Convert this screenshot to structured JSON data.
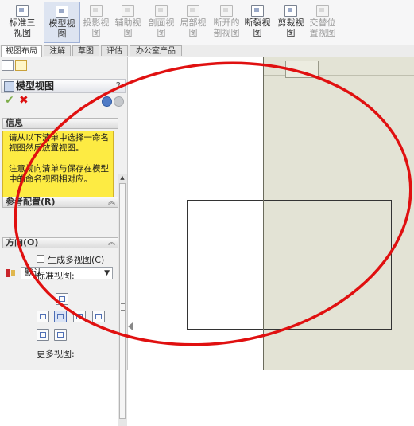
{
  "toolbar": {
    "buttons": [
      {
        "label_line1": "标准三",
        "label_line2": "视图",
        "icon": "standard-3-view-icon",
        "state": "normal"
      },
      {
        "label_line1": "模型视",
        "label_line2": "图",
        "icon": "model-view-icon",
        "state": "active"
      },
      {
        "label_line1": "投影视",
        "label_line2": "图",
        "icon": "projected-view-icon",
        "state": "disabled"
      },
      {
        "label_line1": "辅助视",
        "label_line2": "图",
        "icon": "auxiliary-view-icon",
        "state": "disabled"
      },
      {
        "label_line1": "剖面视",
        "label_line2": "图",
        "icon": "section-view-icon",
        "state": "disabled"
      },
      {
        "label_line1": "局部视",
        "label_line2": "图",
        "icon": "detail-view-icon",
        "state": "disabled"
      },
      {
        "label_line1": "断开的",
        "label_line2": "剖视图",
        "icon": "broken-out-section-icon",
        "state": "disabled"
      },
      {
        "label_line1": "断裂视",
        "label_line2": "图",
        "icon": "break-view-icon",
        "state": "normal"
      },
      {
        "label_line1": "剪裁视",
        "label_line2": "图",
        "icon": "crop-view-icon",
        "state": "normal"
      },
      {
        "label_line1": "交替位",
        "label_line2": "置视图",
        "icon": "alternate-position-view-icon",
        "state": "disabled"
      }
    ]
  },
  "tabs": [
    "视图布局",
    "注解",
    "草图",
    "评估",
    "办公室产品"
  ],
  "panel": {
    "title": "模型视图",
    "help": "?",
    "info": {
      "header": "信息",
      "paragraph1": "请从以下清单中选择一命名视图然后放置视图。",
      "paragraph2": "注意视向清单与保存在模型中的命名视图相对应。"
    },
    "reference_config": {
      "header": "参考配置(R)",
      "value": "默认"
    },
    "orientation": {
      "header": "方向(O)",
      "create_multiple_label": "生成多视图(C)",
      "create_multiple_checked": false,
      "standard_views_label": "标准视图:",
      "more_views_label": "更多视图:"
    }
  },
  "colors": {
    "info_background": "#fdeb43",
    "annotation_ellipse": "#e01010",
    "sheet_background": "#e3e3d5"
  }
}
